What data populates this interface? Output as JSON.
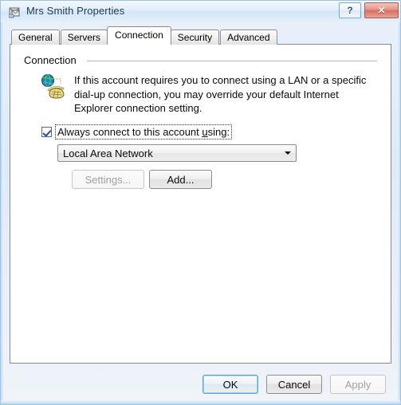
{
  "window": {
    "title": "Mrs Smith Properties",
    "title_icon": "mail-account-icon",
    "caption_buttons": {
      "help_label": "?",
      "help_icon": "question-mark-icon",
      "close_label": "✕",
      "close_icon": "close-x-icon"
    }
  },
  "tabs": [
    {
      "label": "General",
      "active": false
    },
    {
      "label": "Servers",
      "active": false
    },
    {
      "label": "Connection",
      "active": true
    },
    {
      "label": "Security",
      "active": false
    },
    {
      "label": "Advanced",
      "active": false
    }
  ],
  "group": {
    "label": "Connection",
    "icon": "globe-telephone-dialup-icon",
    "description": "If this account requires you to connect using a LAN or a specific dial-up connection, you may override your default Internet Explorer connection setting."
  },
  "checkbox": {
    "checked": true,
    "label_before": "Always connect to this account ",
    "label_accel": "u",
    "label_after": "sing:",
    "icon": "checkmark-icon"
  },
  "combo": {
    "value": "Local Area Network",
    "arrow_icon": "chevron-down-icon"
  },
  "buttons": {
    "settings": {
      "label": "Settings...",
      "enabled": false
    },
    "add": {
      "label": "Add...",
      "enabled": true
    },
    "ok": {
      "label": "OK",
      "enabled": true,
      "default": true
    },
    "cancel": {
      "label": "Cancel",
      "enabled": true
    },
    "apply": {
      "label": "Apply",
      "enabled": false
    }
  },
  "colors": {
    "titlebar_accent": "#d3e6f8",
    "close_button": "#d6705f",
    "default_button_focus": "#5aa4d6",
    "checkmark": "#21519e",
    "disabled_text": "#a0a0a0"
  }
}
